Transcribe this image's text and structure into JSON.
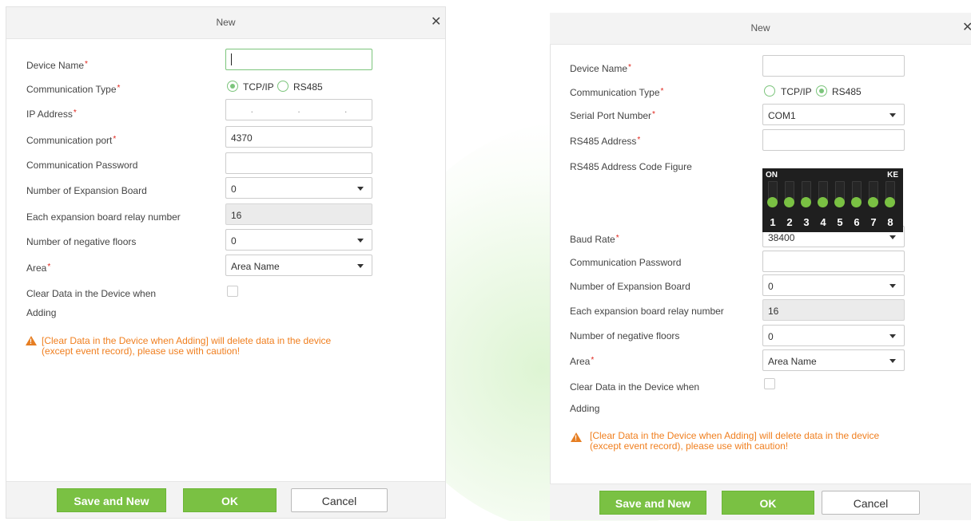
{
  "accent_color": "#7ac143",
  "warning_color": "#f07f1f",
  "dialog_tcp": {
    "title": "New",
    "fields": {
      "device_name": {
        "label": "Device Name",
        "value": ""
      },
      "communication_type": {
        "label": "Communication Type",
        "options": [
          "TCP/IP",
          "RS485"
        ],
        "selected": "TCP/IP"
      },
      "ip_address": {
        "label": "IP Address",
        "value": ". . ."
      },
      "communication_port": {
        "label": "Communication port",
        "value": "4370"
      },
      "communication_password": {
        "label": "Communication Password",
        "value": ""
      },
      "expansion_board": {
        "label": "Number of Expansion Board",
        "value": "0"
      },
      "relay_number": {
        "label": "Each expansion board relay number",
        "value": "16"
      },
      "negative_floors": {
        "label": "Number of negative floors",
        "value": "0"
      },
      "area": {
        "label": "Area",
        "value": "Area Name"
      },
      "clear_data": {
        "label_line1": "Clear Data in the Device when",
        "label_line2": "Adding",
        "checked": false
      }
    },
    "warning": {
      "line1": "[Clear Data in the Device when Adding] will delete data in the device",
      "line2": "(except event record), please use with caution!"
    },
    "buttons": {
      "save_and_new": "Save and New",
      "ok": "OK",
      "cancel": "Cancel"
    }
  },
  "dialog_rs485": {
    "title": "New",
    "fields": {
      "device_name": {
        "label": "Device Name",
        "value": ""
      },
      "communication_type": {
        "label": "Communication Type",
        "options": [
          "TCP/IP",
          "RS485"
        ],
        "selected": "RS485"
      },
      "serial_port": {
        "label": "Serial Port Number",
        "value": "COM1"
      },
      "rs485_address": {
        "label": "RS485 Address",
        "value": ""
      },
      "address_code_figure": {
        "label": "RS485 Address Code Figure",
        "on_label": "ON",
        "ke_label": "KE",
        "switches": [
          "1",
          "2",
          "3",
          "4",
          "5",
          "6",
          "7",
          "8"
        ]
      },
      "baud_rate": {
        "label": "Baud Rate",
        "value": "38400"
      },
      "communication_password": {
        "label": "Communication Password",
        "value": ""
      },
      "expansion_board": {
        "label": "Number of Expansion Board",
        "value": "0"
      },
      "relay_number": {
        "label": "Each expansion board relay number",
        "value": "16"
      },
      "negative_floors": {
        "label": "Number of negative floors",
        "value": "0"
      },
      "area": {
        "label": "Area",
        "value": "Area Name"
      },
      "clear_data": {
        "label_line1": "Clear Data in the Device when",
        "label_line2": "Adding",
        "checked": false
      }
    },
    "warning": {
      "line1": "[Clear Data in the Device when Adding] will delete data in the device",
      "line2": "(except event record), please use with caution!"
    },
    "buttons": {
      "save_and_new": "Save and New",
      "ok": "OK",
      "cancel": "Cancel"
    }
  }
}
